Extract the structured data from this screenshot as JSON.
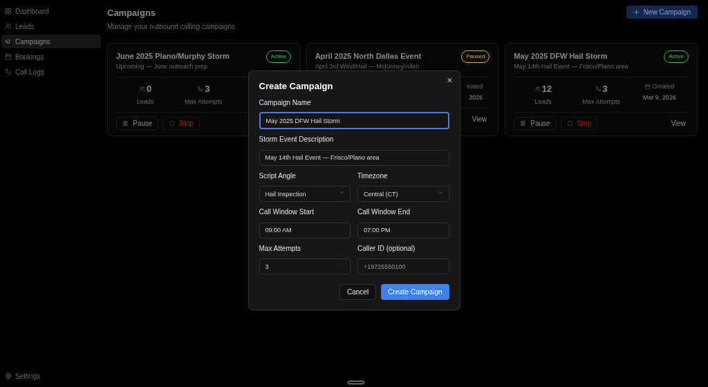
{
  "sidebar": {
    "items": [
      {
        "label": "Dashboard",
        "selected": false
      },
      {
        "label": "Leads",
        "selected": false
      },
      {
        "label": "Campaigns",
        "selected": true
      },
      {
        "label": "Bookings",
        "selected": false
      },
      {
        "label": "Call Logs",
        "selected": false
      }
    ],
    "footer": {
      "label": "Settings"
    }
  },
  "header": {
    "title": "Campaigns",
    "subtitle": "Manage your outbound calling campaigns",
    "button": {
      "label": "New Campaign"
    }
  },
  "campaigns": [
    {
      "title": "June 2025 Plano/Murphy Storm",
      "subtitle": "Upcoming — June outreach prep",
      "status": {
        "label": "Active",
        "color": "#22c55e"
      },
      "stats": [
        {
          "kind": "leads",
          "value": "0",
          "label": "Leads"
        },
        {
          "kind": "attempts",
          "value": "3",
          "label": "Max Attempts"
        }
      ],
      "actions": [
        {
          "kind": "pause",
          "label": "Pause"
        },
        {
          "kind": "stop",
          "label": "Stop"
        }
      ]
    },
    {
      "title": "April 2025 North Dallas Event",
      "subtitle": "April 3rd Wind/Hail — McKinney/Allen",
      "status": {
        "label": "Paused",
        "color": "#eab308"
      },
      "stats": [
        {
          "kind": "created-cut",
          "value": "eated",
          "label": "2026"
        }
      ],
      "actions": [
        {
          "kind": "view",
          "label": "View"
        }
      ]
    },
    {
      "title": "May 2025 DFW Hail Storm",
      "subtitle": "May 14th Hail Event — Frisco/Plano area",
      "status": {
        "label": "Active",
        "color": "#22c55e"
      },
      "stats": [
        {
          "kind": "leads",
          "value": "12",
          "label": "Leads"
        },
        {
          "kind": "attempts",
          "value": "3",
          "label": "Max Attempts"
        },
        {
          "kind": "created",
          "value": "Created",
          "label": "Mar 9, 2026"
        }
      ],
      "actions": [
        {
          "kind": "pause",
          "label": "Pause"
        },
        {
          "kind": "stop",
          "label": "Stop"
        },
        {
          "kind": "view",
          "label": "View"
        }
      ]
    }
  ],
  "dialog": {
    "title": "Create Campaign",
    "close": "×",
    "fields": [
      {
        "kind": "text",
        "label": "Campaign Name",
        "value": "May 2025 DFW Hail Storm",
        "focused": true
      },
      {
        "kind": "text",
        "label": "Storm Event Description",
        "value": "May 14th Hail Event — Frisco/Plano area",
        "focused": false
      },
      {
        "kind": "select",
        "label": "Script Angle",
        "value": "Hail Inspection",
        "focused": false
      },
      {
        "kind": "select",
        "label": "Timezone",
        "value": "Central (CT)",
        "focused": false
      },
      {
        "kind": "text",
        "label": "Call Window Start",
        "value": "09:00 AM",
        "focused": false
      },
      {
        "kind": "text",
        "label": "Call Window End",
        "value": "07:00 PM",
        "focused": false
      },
      {
        "kind": "number",
        "label": "Max Attempts",
        "value": "3",
        "focused": false
      },
      {
        "kind": "text",
        "label": "Caller ID (optional)",
        "placeholder": "+19725550100",
        "focused": false
      }
    ],
    "buttons": [
      {
        "kind": "secondary",
        "label": "Cancel"
      },
      {
        "kind": "primary",
        "label": "Create Campaign"
      }
    ]
  }
}
